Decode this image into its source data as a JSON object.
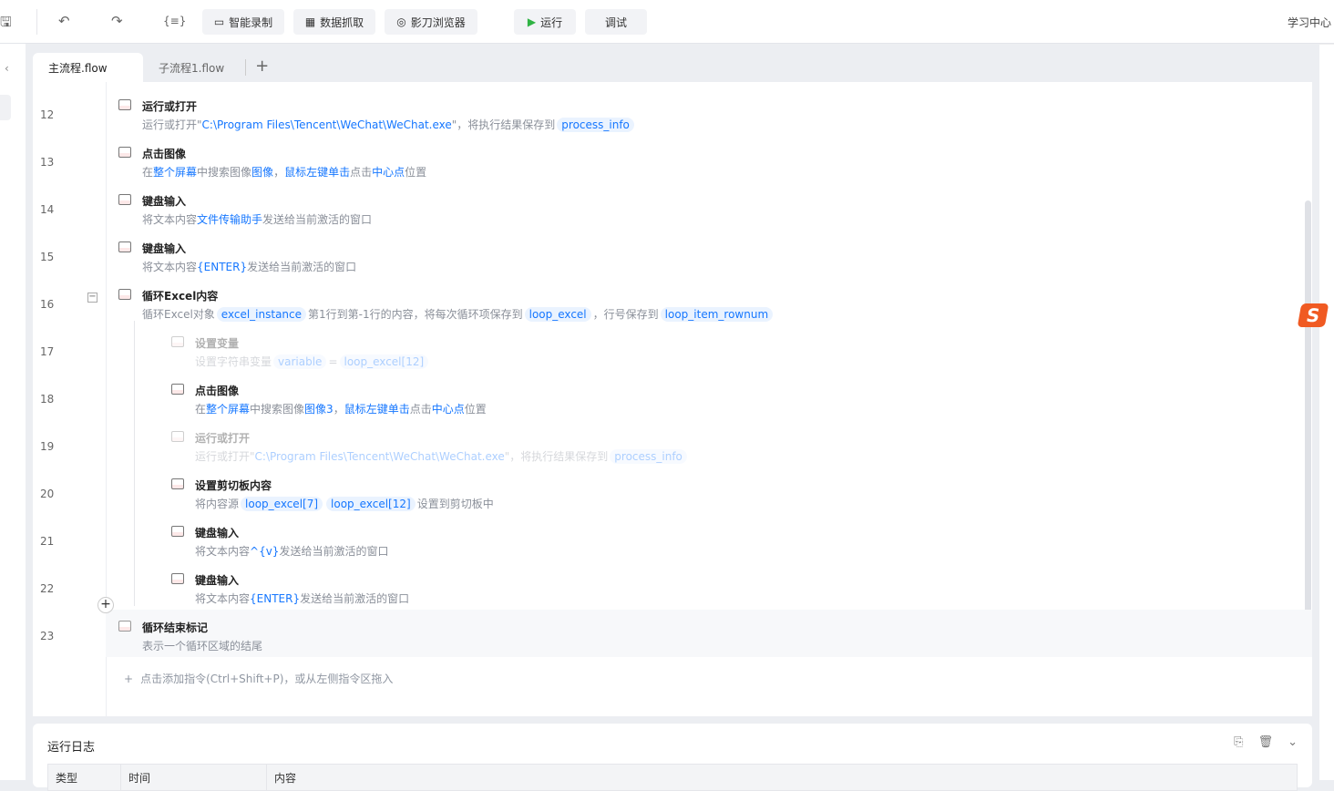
{
  "toolbar": {
    "record": "智能录制",
    "extract": "数据抓取",
    "browser": "影刀浏览器",
    "run": "运行",
    "debug": "调试",
    "learn": "学习中心",
    "var_icon": "{≡}"
  },
  "tabs": [
    {
      "label": "主流程.flow"
    },
    {
      "label": "子流程1.flow"
    }
  ],
  "rows": [
    {
      "num": "12",
      "title": "运行或打开",
      "icon": "run-open-icon",
      "indent": 0,
      "desc": [
        [
          "p",
          "运行或打开\""
        ],
        [
          "b",
          "C:\\Program Files\\Tencent\\WeChat\\WeChat.exe"
        ],
        [
          "p",
          "\"，将执行结果保存到"
        ],
        [
          "c",
          "process_info"
        ]
      ]
    },
    {
      "num": "13",
      "title": "点击图像",
      "icon": "click-image-icon",
      "indent": 0,
      "desc": [
        [
          "p",
          "在"
        ],
        [
          "b",
          "整个屏幕"
        ],
        [
          "p",
          "中搜索图像"
        ],
        [
          "b",
          "图像"
        ],
        [
          "p",
          "，"
        ],
        [
          "b",
          "鼠标左键单击"
        ],
        [
          "p",
          "点击"
        ],
        [
          "b",
          "中心点"
        ],
        [
          "p",
          "位置"
        ]
      ]
    },
    {
      "num": "14",
      "title": "键盘输入",
      "icon": "keyboard-icon",
      "indent": 0,
      "desc": [
        [
          "p",
          "将文本内容"
        ],
        [
          "b",
          "文件传输助手"
        ],
        [
          "p",
          "发送给当前激活的窗口"
        ]
      ]
    },
    {
      "num": "15",
      "title": "键盘输入",
      "icon": "keyboard-icon",
      "indent": 0,
      "desc": [
        [
          "p",
          "将文本内容"
        ],
        [
          "b",
          "{ENTER}"
        ],
        [
          "p",
          "发送给当前激活的窗口"
        ]
      ]
    },
    {
      "num": "16",
      "title": "循环Excel内容",
      "icon": "loop-excel-icon",
      "indent": 0,
      "desc": [
        [
          "p",
          "循环Excel对象"
        ],
        [
          "c",
          "excel_instance"
        ],
        [
          "p",
          "第1行到第-1行的内容，将每次循环项保存到"
        ],
        [
          "c",
          "loop_excel"
        ],
        [
          "p",
          "，行号保存到"
        ],
        [
          "c",
          "loop_item_rownum"
        ]
      ]
    },
    {
      "num": "17",
      "title": "设置变量",
      "icon": "set-variable-icon",
      "indent": 1,
      "disabled": true,
      "desc": [
        [
          "p",
          "设置字符串变量"
        ],
        [
          "c",
          "variable"
        ],
        [
          "p",
          "="
        ],
        [
          "c",
          "loop_excel[12]"
        ]
      ]
    },
    {
      "num": "18",
      "title": "点击图像",
      "icon": "click-image-icon",
      "indent": 1,
      "desc": [
        [
          "p",
          "在"
        ],
        [
          "b",
          "整个屏幕"
        ],
        [
          "p",
          "中搜索图像"
        ],
        [
          "b",
          "图像3"
        ],
        [
          "p",
          "，"
        ],
        [
          "b",
          "鼠标左键单击"
        ],
        [
          "p",
          "点击"
        ],
        [
          "b",
          "中心点"
        ],
        [
          "p",
          "位置"
        ]
      ]
    },
    {
      "num": "19",
      "title": "运行或打开",
      "icon": "run-open-icon",
      "indent": 1,
      "disabled": true,
      "desc": [
        [
          "p",
          "运行或打开\""
        ],
        [
          "b",
          "C:\\Program Files\\Tencent\\WeChat\\WeChat.exe"
        ],
        [
          "p",
          "\"，将执行结果保存到"
        ],
        [
          "c",
          "process_info"
        ]
      ]
    },
    {
      "num": "20",
      "title": "设置剪切板内容",
      "icon": "clipboard-icon",
      "indent": 1,
      "desc": [
        [
          "p",
          "将内容源"
        ],
        [
          "c",
          "loop_excel[7]"
        ],
        [
          "c",
          "loop_excel[12]"
        ],
        [
          "p",
          "设置到剪切板中"
        ]
      ]
    },
    {
      "num": "21",
      "title": "键盘输入",
      "icon": "keyboard-icon",
      "indent": 1,
      "desc": [
        [
          "p",
          "将文本内容"
        ],
        [
          "b",
          "^{v}"
        ],
        [
          "p",
          "发送给当前激活的窗口"
        ]
      ]
    },
    {
      "num": "22",
      "title": "键盘输入",
      "icon": "keyboard-icon",
      "indent": 1,
      "desc": [
        [
          "p",
          "将文本内容"
        ],
        [
          "b",
          "{ENTER}"
        ],
        [
          "p",
          "发送给当前激活的窗口"
        ]
      ]
    },
    {
      "num": "23",
      "title": "循环结束标记",
      "icon": "loop-end-icon",
      "indent": 0,
      "highlight": true,
      "desc": [
        [
          "p",
          "表示一个循环区域的结尾"
        ]
      ]
    }
  ],
  "add_hint": "点击添加指令(Ctrl+Shift+P)，或从左侧指令区拖入",
  "log": {
    "title": "运行日志",
    "columns": [
      "类型",
      "时间",
      "内容"
    ]
  }
}
